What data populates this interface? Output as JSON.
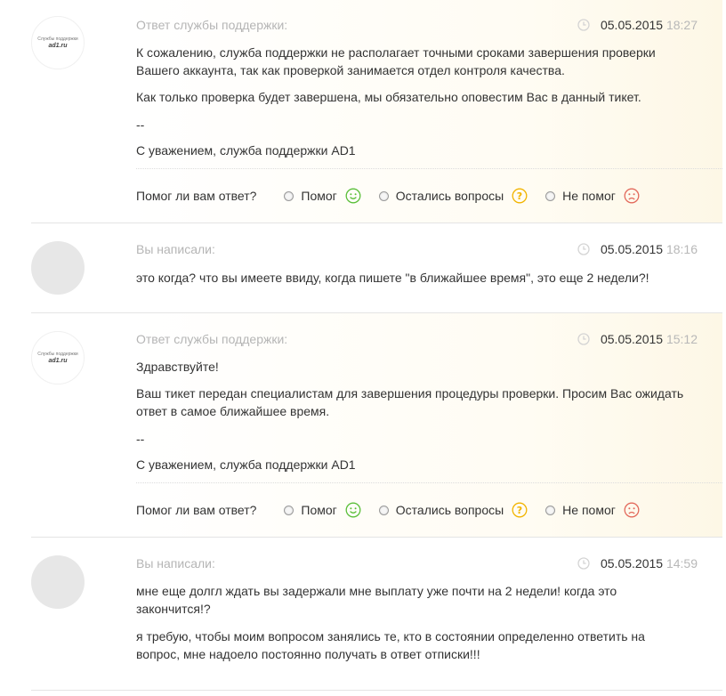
{
  "colors": {
    "smile_good": "#5bbf3a",
    "smile_question": "#f2b400",
    "smile_bad": "#e36a5c"
  },
  "avatar": {
    "support_caption": "Службы поддержки",
    "support_brand": "ad1.ru"
  },
  "rating": {
    "question": "Помог ли вам ответ?",
    "helped": "Помог",
    "questions_left": "Остались вопросы",
    "not_helped": "Не помог"
  },
  "messages": [
    {
      "author": "Ответ службы поддержки:",
      "date": "05.05.2015",
      "time": "18:27",
      "paragraphs": [
        "К сожалению, служба поддержки не располагает точными сроками завершения проверки Вашего аккаунта, так как проверкой занимается отдел контроля качества.",
        "Как только проверка будет завершена, мы обязательно оповестим Вас в данный тикет.",
        "--",
        "С уважением, служба поддержки AD1"
      ]
    },
    {
      "author": "Вы написали:",
      "date": "05.05.2015",
      "time": "18:16",
      "paragraphs": [
        "это когда? что вы имеете ввиду, когда пишете \"в ближайшее время\", это еще 2 недели?!"
      ]
    },
    {
      "author": "Ответ службы поддержки:",
      "date": "05.05.2015",
      "time": "15:12",
      "paragraphs": [
        "Здравствуйте!",
        "Ваш тикет передан специалистам для завершения процедуры проверки. Просим Вас ожидать ответ в самое ближайшее время.",
        "--",
        "С уважением, служба поддержки AD1"
      ]
    },
    {
      "author": "Вы написали:",
      "date": "05.05.2015",
      "time": "14:59",
      "paragraphs": [
        "мне еще долгл ждать вы задержали мне выплату уже почти на 2 недели! когда это закончится!?",
        "я требую, чтобы моим вопросом занялись те, кто в состоянии определенно ответить на вопрос, мне надоело постоянно получать в ответ отписки!!!"
      ]
    }
  ]
}
